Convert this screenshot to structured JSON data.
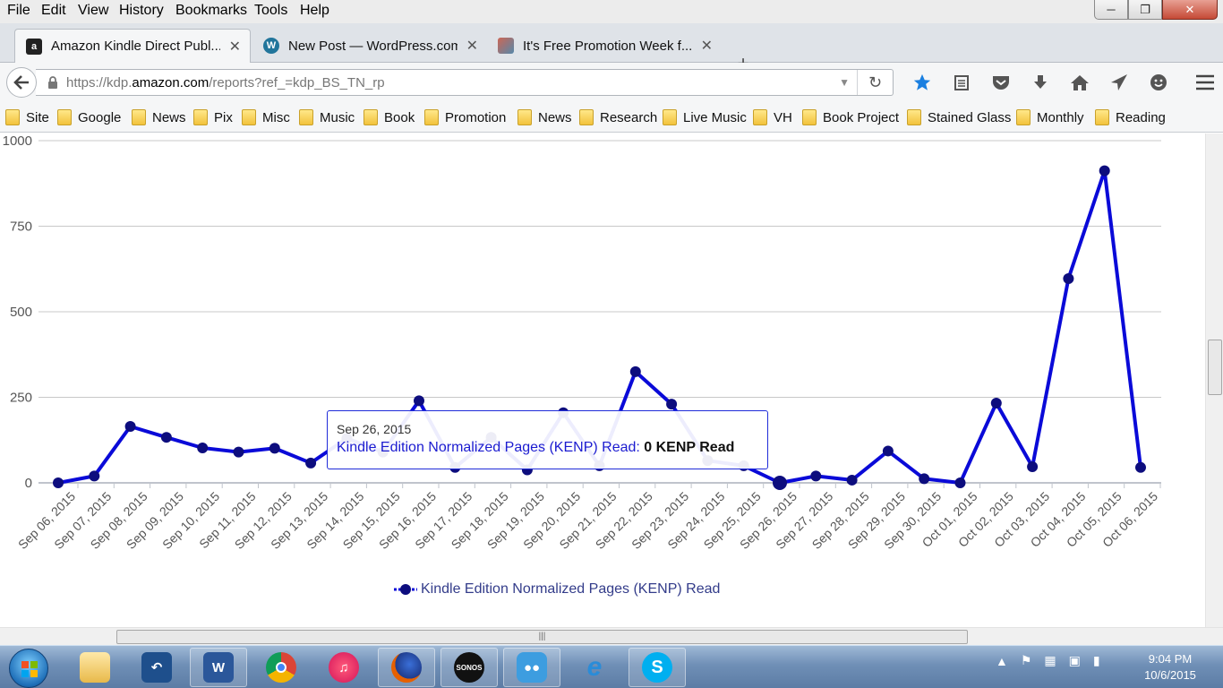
{
  "menubar": {
    "items": [
      "File",
      "Edit",
      "View",
      "History",
      "Bookmarks",
      "Tools",
      "Help"
    ]
  },
  "tabs": [
    {
      "title": "Amazon Kindle Direct Publ...",
      "icon": "amazon-icon"
    },
    {
      "title": "New Post — WordPress.com",
      "icon": "wordpress-icon"
    },
    {
      "title": "It's Free Promotion Week f...",
      "icon": "blog-icon"
    }
  ],
  "urlbar": {
    "url_prefix": "https://kdp.",
    "url_domain": "amazon.com",
    "url_path": "/reports?ref_=kdp_BS_TN_rp"
  },
  "bookmarks": [
    "Site",
    "Google",
    "News",
    "Pix",
    "Misc",
    "Music",
    "Book",
    "Promotion",
    "News",
    "Research",
    "Live Music",
    "VH",
    "Book Project",
    "Stained Glass",
    "Monthly",
    "Reading"
  ],
  "chart_data": {
    "type": "line",
    "categories": [
      "Sep 06, 2015",
      "Sep 07, 2015",
      "Sep 08, 2015",
      "Sep 09, 2015",
      "Sep 10, 2015",
      "Sep 11, 2015",
      "Sep 12, 2015",
      "Sep 13, 2015",
      "Sep 14, 2015",
      "Sep 15, 2015",
      "Sep 16, 2015",
      "Sep 17, 2015",
      "Sep 18, 2015",
      "Sep 19, 2015",
      "Sep 20, 2015",
      "Sep 21, 2015",
      "Sep 22, 2015",
      "Sep 23, 2015",
      "Sep 24, 2015",
      "Sep 25, 2015",
      "Sep 26, 2015",
      "Sep 27, 2015",
      "Sep 28, 2015",
      "Sep 29, 2015",
      "Sep 30, 2015",
      "Oct 01, 2015",
      "Oct 02, 2015",
      "Oct 03, 2015",
      "Oct 04, 2015",
      "Oct 05, 2015",
      "Oct 06, 2015"
    ],
    "series": [
      {
        "name": "Kindle Edition Normalized Pages (KENP) Read",
        "color": "#0a0ad8",
        "marker_color": "#0d0d7e",
        "values": [
          0,
          20,
          165,
          133,
          102,
          90,
          101,
          58,
          130,
          90,
          240,
          45,
          133,
          38,
          205,
          50,
          325,
          230,
          65,
          50,
          0,
          20,
          8,
          93,
          12,
          0,
          233,
          47,
          597,
          912,
          45
        ]
      }
    ],
    "yticks": [
      "0",
      "250",
      "500",
      "750",
      "1000"
    ],
    "ytick_values": [
      0,
      250,
      500,
      750,
      1000
    ],
    "ylim": [
      0,
      1000
    ],
    "grid": true,
    "legend": "bottom-center",
    "highlight_index": 20
  },
  "tooltip": {
    "date": "Sep 26, 2015",
    "series_label": "Kindle Edition Normalized Pages (KENP) Read:",
    "value": "0 KENP Read"
  },
  "legend": {
    "label": "Kindle Edition Normalized Pages (KENP) Read"
  },
  "taskbar": {
    "apps": [
      "windows-explorer-icon",
      "rdp-icon",
      "word-icon",
      "chrome-icon",
      "itunes-icon",
      "firefox-icon",
      "sonos-icon",
      "messenger-icon",
      "ie-icon",
      "skype-icon"
    ],
    "sonos_label": "SONOS",
    "time": "9:04 PM",
    "date": "10/6/2015"
  }
}
